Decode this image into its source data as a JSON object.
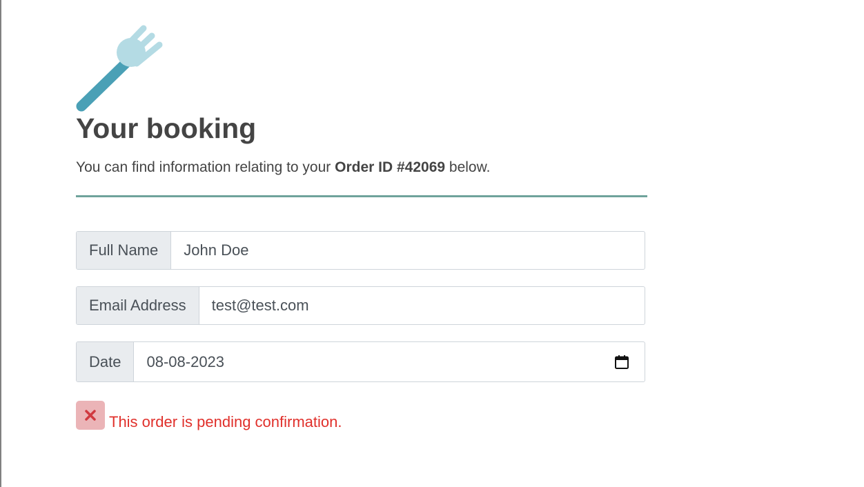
{
  "header": {
    "logo_icon": "fork-icon",
    "title": "Your booking",
    "intro_prefix": "You can find information relating to your ",
    "intro_order": "Order ID #42069",
    "intro_suffix": " below."
  },
  "form": {
    "full_name": {
      "label": "Full Name",
      "value": "John Doe"
    },
    "email": {
      "label": "Email Address",
      "value": "test@test.com"
    },
    "date": {
      "label": "Date",
      "value": "08-08-2023"
    }
  },
  "status": {
    "icon": "close-icon",
    "text": "This order is pending confirmation."
  },
  "colors": {
    "accent_divider": "#6fa39b",
    "status_text": "#e0302b",
    "status_icon_bg": "#ebb4b7",
    "fork_handle": "#4aa0b6",
    "fork_head": "#b4dbe4"
  }
}
